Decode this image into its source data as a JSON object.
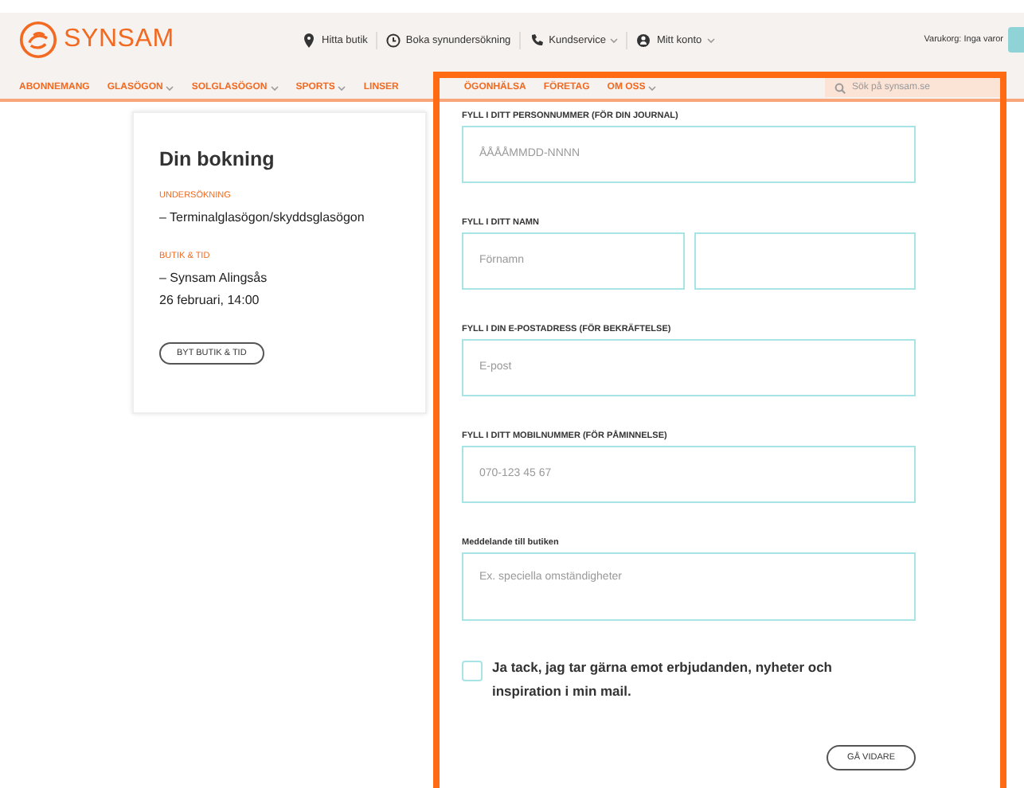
{
  "header": {
    "logo": "SYNSAM",
    "links": [
      {
        "label": "Hitta butik",
        "dropdown": false
      },
      {
        "label": "Boka synundersökning",
        "dropdown": false
      },
      {
        "label": "Kundservice",
        "dropdown": true
      },
      {
        "label": "Mitt konto",
        "dropdown": true
      }
    ],
    "cart": "Varukorg: Inga varor"
  },
  "nav": {
    "items": [
      {
        "label": "ABONNEMANG",
        "dropdown": false
      },
      {
        "label": "GLASÖGON",
        "dropdown": true
      },
      {
        "label": "SOLGLASÖGON",
        "dropdown": true
      },
      {
        "label": "SPORTS",
        "dropdown": true
      },
      {
        "label": "LINSER",
        "dropdown": false
      },
      {
        "label": "ÖGONHÄLSA",
        "dropdown": false
      },
      {
        "label": "FÖRETAG",
        "dropdown": false
      },
      {
        "label": "OM OSS",
        "dropdown": true
      }
    ],
    "search": {
      "placeholder": "Sök på synsam.se"
    }
  },
  "booking": {
    "title": "Din bokning",
    "sections": [
      {
        "heading": "UNDERSÖKNING",
        "lines": [
          "– Terminalglasögon/skyddsglasögon"
        ]
      },
      {
        "heading": "BUTIK & TID",
        "lines": [
          "– Synsam Alingsås",
          "26 februari, 14:00"
        ]
      }
    ],
    "button": "BYT BUTIK & TID"
  },
  "form": {
    "groups": [
      {
        "label": "FYLL I DITT PERSONNUMMER (FÖR DIN JOURNAL)",
        "kind": "input",
        "placeholder": "ÅÅÅÅMMDD-NNNN"
      },
      {
        "label": "FYLL I DITT NAMN",
        "kind": "pair",
        "placeholder": "Förnamn"
      },
      {
        "label": "FYLL I DIN E-POSTADRESS (FÖR BEKRÄFTELSE)",
        "kind": "input",
        "placeholder": "E-post"
      },
      {
        "label": "FYLL I DITT MOBILNUMMER (FÖR PÅMINNELSE)",
        "kind": "input",
        "placeholder": "070-123 45 67"
      },
      {
        "label": "Meddelande till butiken",
        "kind": "textarea",
        "placeholder": "Ex. speciella omständigheter"
      }
    ],
    "consent": {
      "label": "Ja tack, jag tar gärna emot erbjudanden, nyheter och inspiration i min mail.",
      "checked": false
    },
    "submit": "GÅ VIDARE"
  }
}
